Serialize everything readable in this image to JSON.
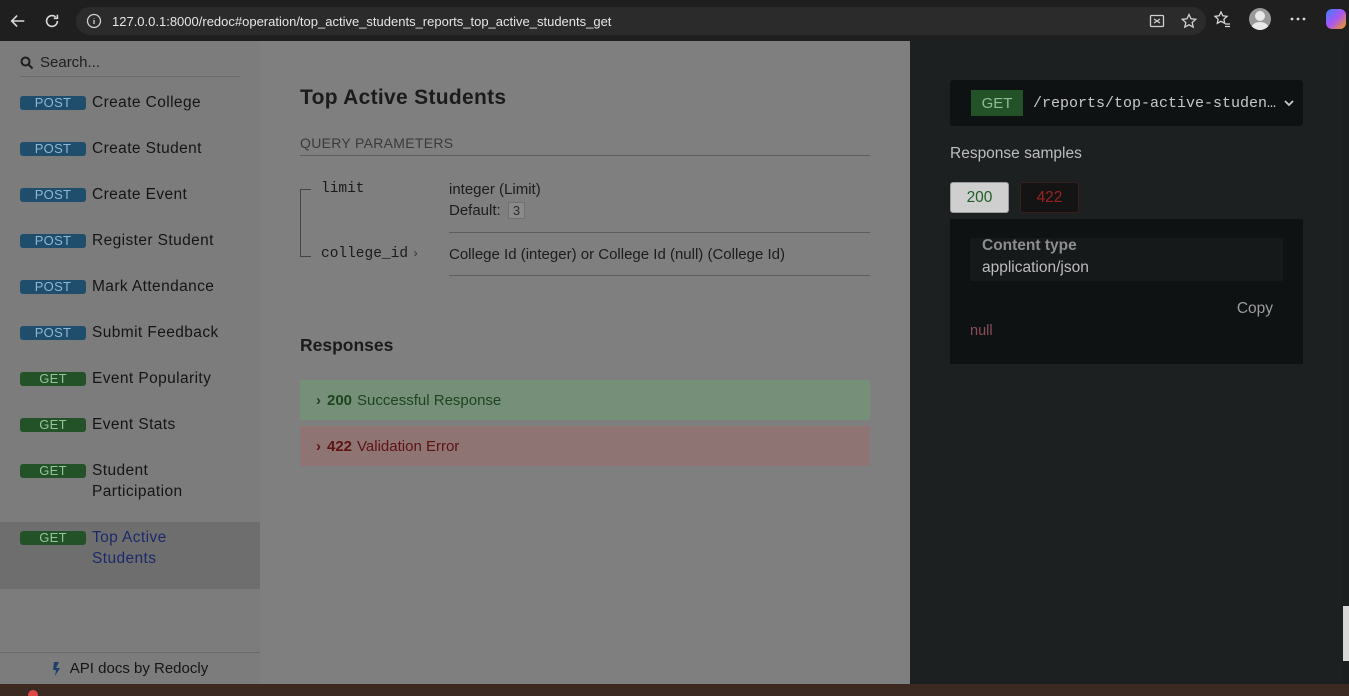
{
  "browser": {
    "url": "127.0.0.1:8000/redoc#operation/top_active_students_reports_top_active_students_get"
  },
  "sidebar": {
    "search_placeholder": "Search...",
    "items": [
      {
        "method": "POST",
        "label": "Create College"
      },
      {
        "method": "POST",
        "label": "Create Student"
      },
      {
        "method": "POST",
        "label": "Create Event"
      },
      {
        "method": "POST",
        "label": "Register Student"
      },
      {
        "method": "POST",
        "label": "Mark Attendance"
      },
      {
        "method": "POST",
        "label": "Submit Feedback"
      },
      {
        "method": "GET",
        "label": "Event Popularity"
      },
      {
        "method": "GET",
        "label": "Event Stats"
      },
      {
        "method": "GET",
        "label": "Student Participation"
      },
      {
        "method": "GET",
        "label": "Top Active Students",
        "active": true
      }
    ],
    "footer": "API docs by Redocly"
  },
  "operation": {
    "title": "Top Active Students",
    "query_params_header": "QUERY PARAMETERS",
    "params": [
      {
        "name": "limit",
        "type": "integer (Limit)",
        "default_label": "Default:",
        "default": "3"
      },
      {
        "name": "college_id",
        "type": "College Id (integer) or College Id (null) (College Id)"
      }
    ],
    "responses_title": "Responses",
    "responses": [
      {
        "code": "200",
        "label": "Successful Response"
      },
      {
        "code": "422",
        "label": "Validation Error"
      }
    ]
  },
  "right_panel": {
    "method": "GET",
    "path": "/reports/top-active-students",
    "samples_title": "Response samples",
    "tabs": [
      "200",
      "422"
    ],
    "content_type_label": "Content type",
    "content_type_value": "application/json",
    "copy_label": "Copy",
    "sample_body": "null"
  },
  "colors": {
    "post_badge": "#1f4d6c",
    "get_badge": "#245228",
    "success_bg": "#768f78",
    "error_bg": "#8f7474",
    "right_panel_bg": "#1c2021"
  }
}
